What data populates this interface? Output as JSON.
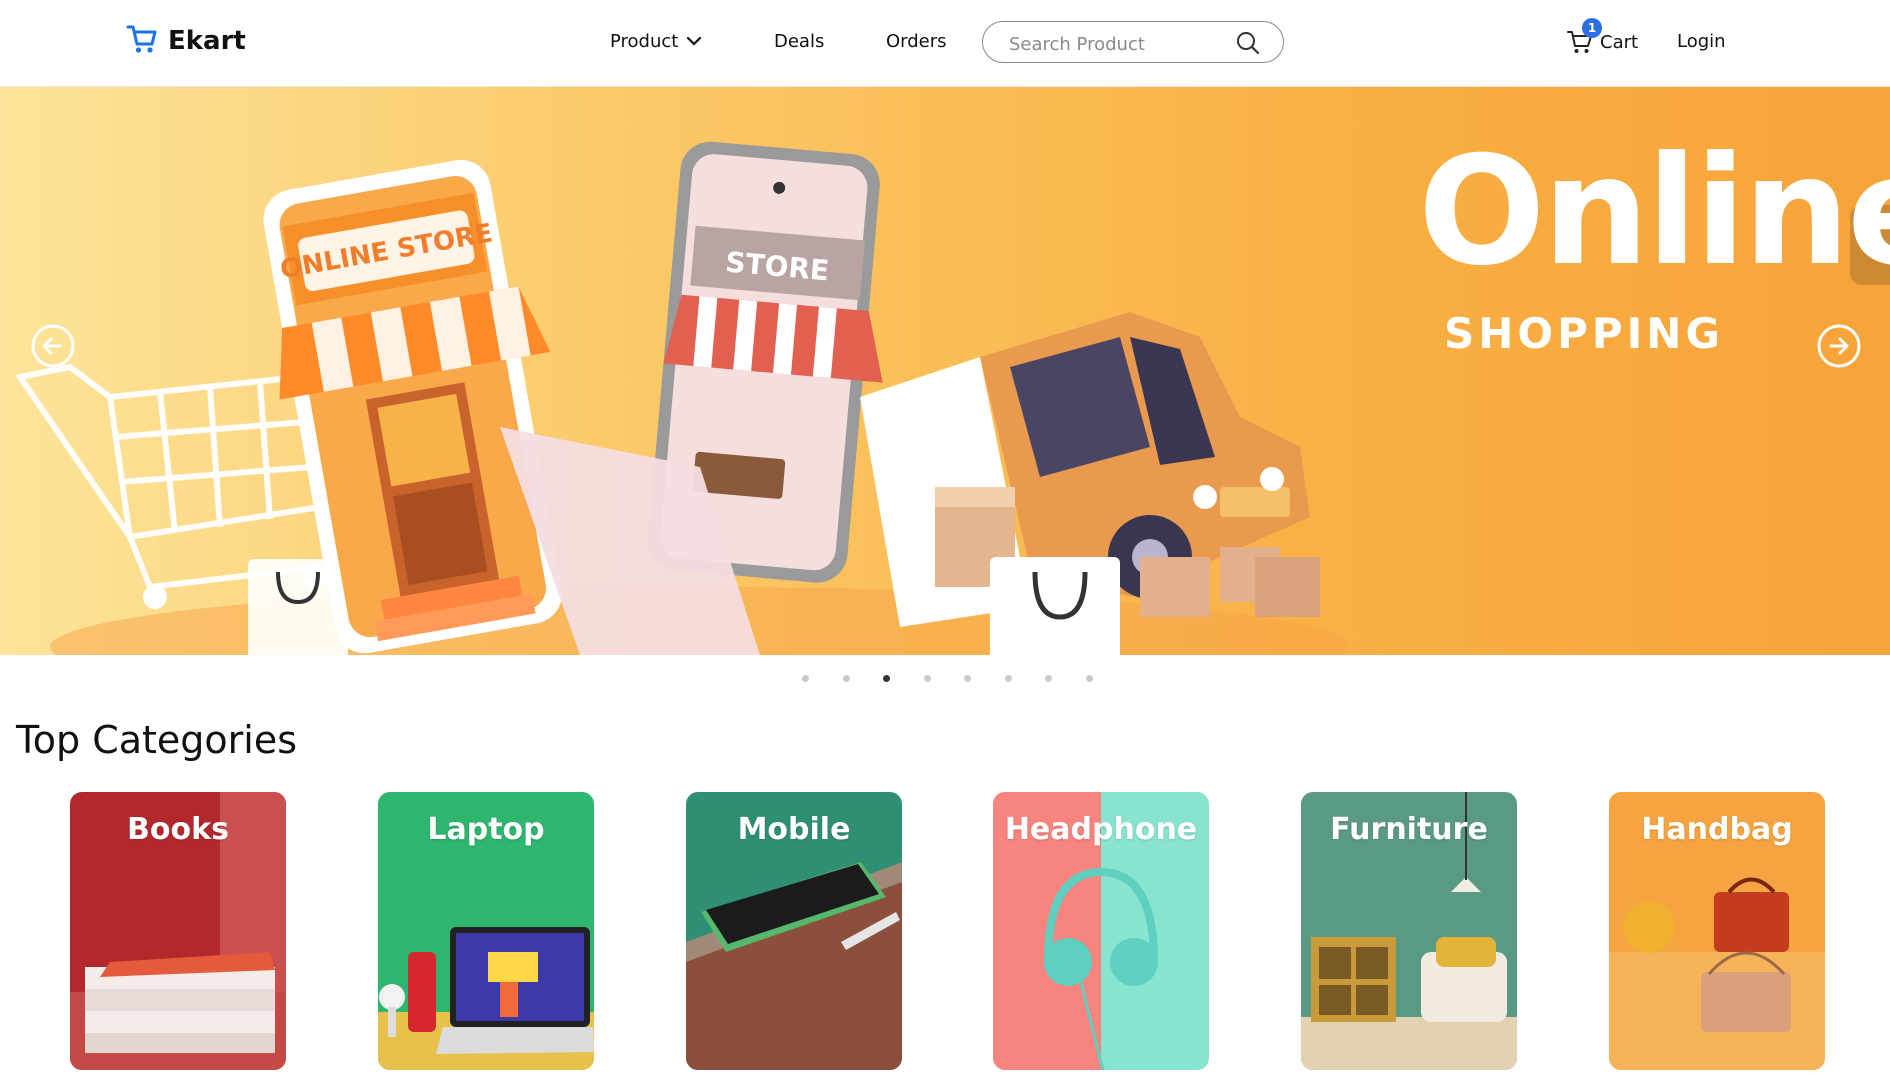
{
  "brand": {
    "name": "Ekart",
    "icon": "cart-icon",
    "color": "#1a73e8"
  },
  "nav": {
    "product_label": "Product",
    "deals_label": "Deals",
    "orders_label": "Orders",
    "search_placeholder": "Search Product",
    "cart_label": "Cart",
    "cart_count": "1",
    "login_label": "Login"
  },
  "hero": {
    "title": "Online.",
    "subtitle": "SHOPPING",
    "storefront_sign": "ONLINE STORE",
    "phone_sign": "STORE",
    "slide_count": 8,
    "active_slide": 3,
    "colors": {
      "gradient_start": "#fde49a",
      "gradient_end": "#f7a43a"
    }
  },
  "categories": {
    "heading": "Top Categories",
    "items": [
      {
        "label": "Books",
        "bg": "#b3282d"
      },
      {
        "label": "Laptop",
        "bg": "#2eb56e"
      },
      {
        "label": "Mobile",
        "bg": "#2f8f74"
      },
      {
        "label": "Headphone",
        "bg": "#f7847f"
      },
      {
        "label": "Furniture",
        "bg": "#5b9a82"
      },
      {
        "label": "Handbag",
        "bg": "#f5a441"
      }
    ]
  }
}
